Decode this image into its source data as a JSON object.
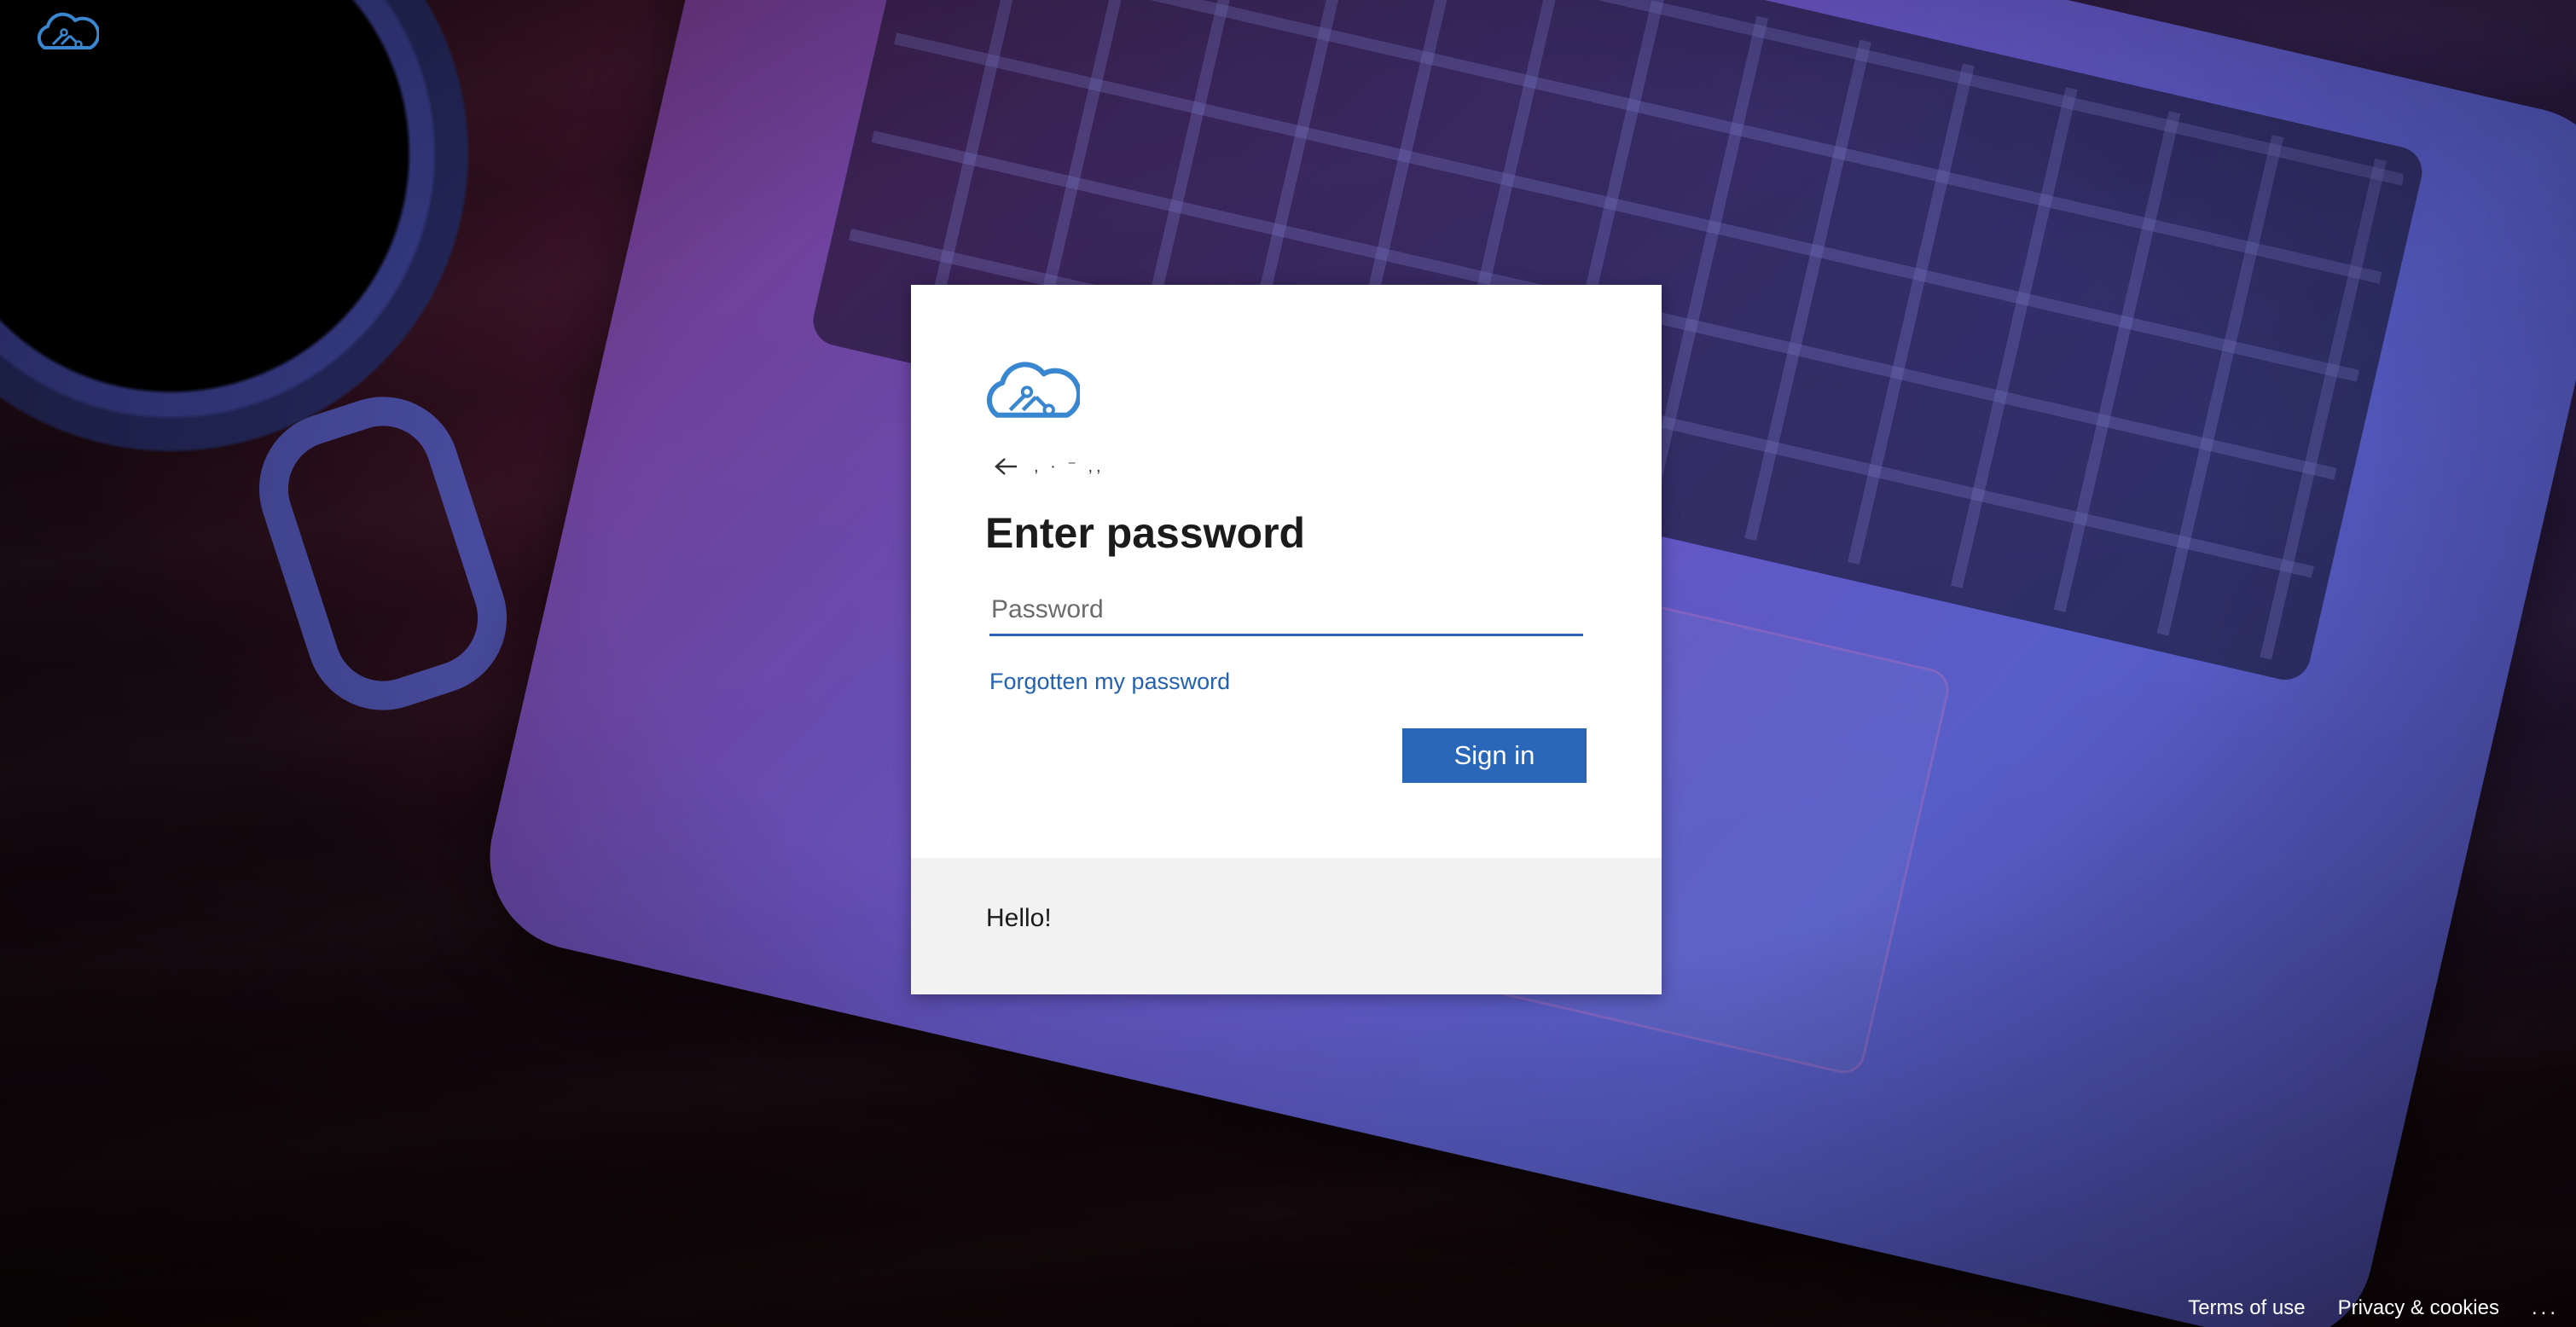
{
  "header": {
    "logo_icon": "cloud-circuit-icon"
  },
  "signin": {
    "logo_icon": "cloud-circuit-icon",
    "back_icon": "arrow-left-icon",
    "identity": ",    ·    ⁻        ,,",
    "title": "Enter password",
    "password": {
      "value": "",
      "placeholder": "Password"
    },
    "forgot_link": "Forgotten my password",
    "signin_button": "Sign in",
    "footer_message": "Hello!"
  },
  "footer": {
    "terms": "Terms of use",
    "privacy": "Privacy & cookies",
    "more": "..."
  },
  "colors": {
    "accent": "#2b67b9",
    "link": "#2360b1",
    "logo": "#3a87d1"
  }
}
